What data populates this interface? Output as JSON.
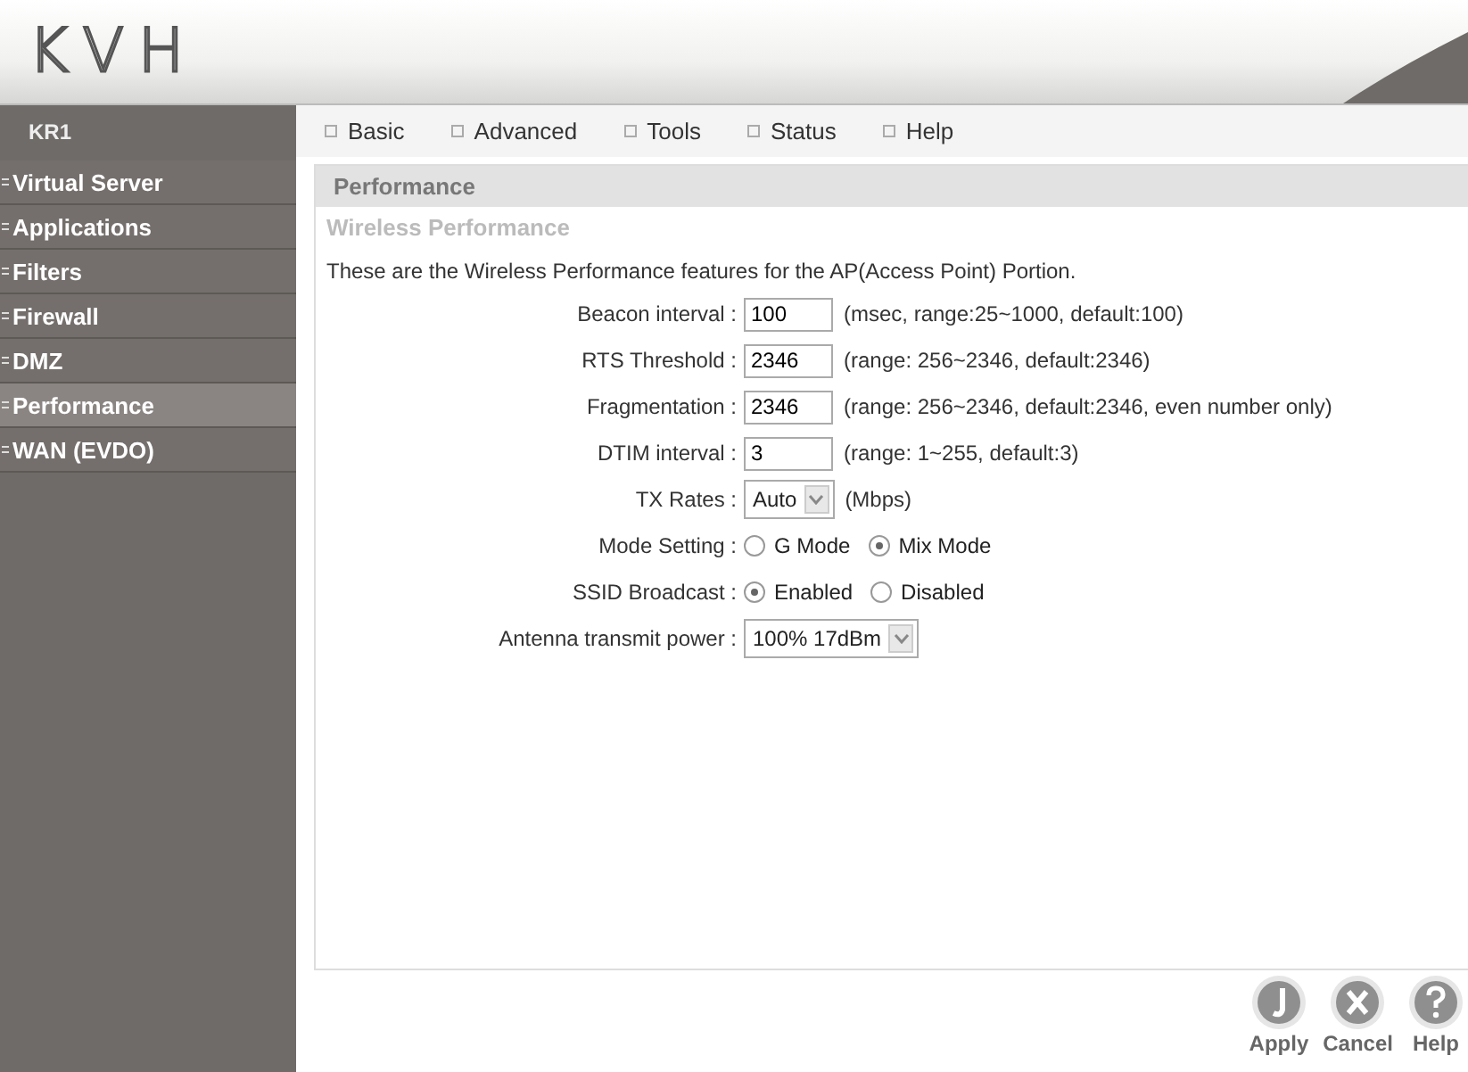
{
  "logo": "KVH",
  "device": "KR1",
  "nav": [
    {
      "label": "Basic"
    },
    {
      "label": "Advanced"
    },
    {
      "label": "Tools"
    },
    {
      "label": "Status"
    },
    {
      "label": "Help"
    }
  ],
  "sidebar": {
    "items": [
      {
        "label": "Virtual Server",
        "selected": false
      },
      {
        "label": "Applications",
        "selected": false
      },
      {
        "label": "Filters",
        "selected": false
      },
      {
        "label": "Firewall",
        "selected": false
      },
      {
        "label": "DMZ",
        "selected": false
      },
      {
        "label": "Performance",
        "selected": true
      },
      {
        "label": "WAN (EVDO)",
        "selected": false
      }
    ]
  },
  "panel": {
    "title": "Performance",
    "subtitle": "Wireless Performance",
    "description": "These are the Wireless Performance features for the AP(Access Point) Portion.",
    "fields": [
      {
        "kind": "text",
        "label": "Beacon interval :",
        "value": "100",
        "hint": "(msec, range:25~1000, default:100)"
      },
      {
        "kind": "text",
        "label": "RTS Threshold :",
        "value": "2346",
        "hint": "(range: 256~2346, default:2346)"
      },
      {
        "kind": "text",
        "label": "Fragmentation :",
        "value": "2346",
        "hint": "(range: 256~2346, default:2346, even number only)"
      },
      {
        "kind": "text",
        "label": "DTIM interval :",
        "value": "3",
        "hint": "(range: 1~255, default:3)"
      },
      {
        "kind": "select",
        "label": "TX Rates :",
        "value": "Auto",
        "hint": "(Mbps)"
      },
      {
        "kind": "radio",
        "label": "Mode Setting :",
        "options": [
          {
            "label": "G Mode",
            "selected": false
          },
          {
            "label": "Mix Mode",
            "selected": true
          }
        ]
      },
      {
        "kind": "radio",
        "label": "SSID Broadcast :",
        "options": [
          {
            "label": "Enabled",
            "selected": true
          },
          {
            "label": "Disabled",
            "selected": false
          }
        ]
      },
      {
        "kind": "select",
        "label": "Antenna transmit power :",
        "value": "100% 17dBm"
      }
    ]
  },
  "buttons": [
    {
      "kind": "apply",
      "label": "Apply"
    },
    {
      "kind": "cancel",
      "label": "Cancel"
    },
    {
      "kind": "help",
      "label": "Help"
    }
  ]
}
